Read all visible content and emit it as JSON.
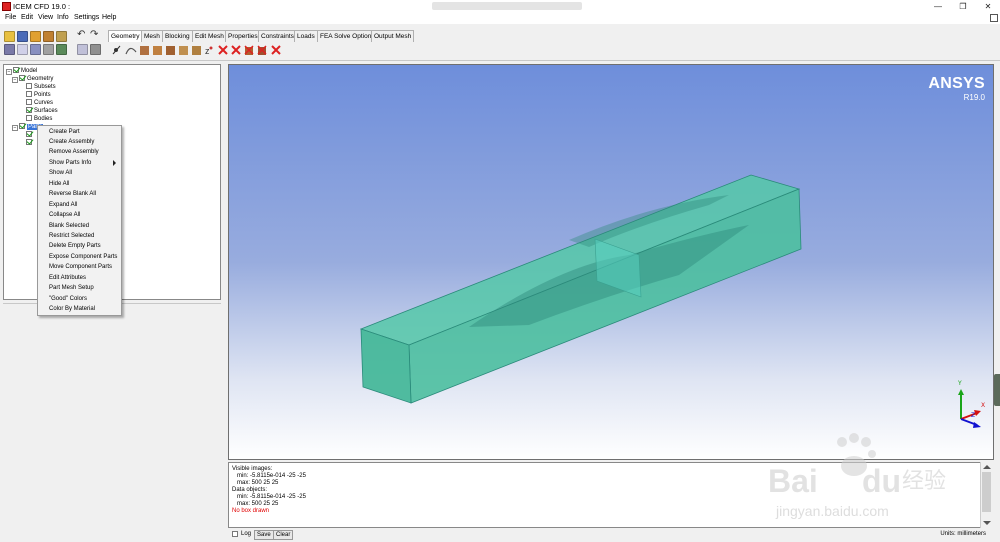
{
  "window": {
    "title": "ICEM CFD 19.0 :",
    "minimize_glyph": "—",
    "restore_glyph": "❐",
    "close_glyph": "✕"
  },
  "menubar": {
    "items": [
      "File",
      "Edit",
      "View",
      "Info",
      "Settings",
      "Help"
    ]
  },
  "toolbar": {
    "undo_glyph": "↶",
    "redo_glyph": "↷",
    "tabs": [
      "Geometry",
      "Mesh",
      "Blocking",
      "Edit Mesh",
      "Properties",
      "Constraints",
      "Loads",
      "FEA Solve Options",
      "Output Mesh"
    ],
    "active_tab": "Geometry"
  },
  "tree": {
    "root": "Model",
    "geometry": "Geometry",
    "children": [
      "Subsets",
      "Points",
      "Curves",
      "Surfaces",
      "Bodies"
    ],
    "children_checked": [
      false,
      false,
      false,
      true,
      false
    ],
    "selected_label": "Parts",
    "expander_minus": "−",
    "expander_plus": "+"
  },
  "context_menu": {
    "items": [
      "Create Part",
      "Create Assembly",
      "Remove Assembly",
      "Show Parts Info",
      "Show All",
      "Hide All",
      "Reverse Blank All",
      "Expand All",
      "Collapse All",
      "Blank Selected",
      "Restrict Selected",
      "Delete Empty Parts",
      "Expose Component Parts",
      "Move Component Parts",
      "Edit Attributes",
      "Part Mesh Setup",
      "\"Good\" Colors",
      "Color By Material"
    ],
    "submenu_index": 3
  },
  "viewport": {
    "logo": "ANSYS",
    "version": "R19.0",
    "axes": {
      "x": "X",
      "y": "Y",
      "z": "Z"
    },
    "colors": {
      "box_face": "#4fc6a6",
      "box_edge": "#2a8a7a",
      "axis_x": "#d41010",
      "axis_y": "#1aa51a",
      "axis_z": "#1010d0"
    }
  },
  "messages": {
    "lines": [
      "Visible images:",
      "   min: -5.8115e-014 -25 -25",
      "   max: 500 25 25",
      "Data objects:",
      "   min: -5.8115e-014 -25 -25",
      "   max: 500 25 25"
    ],
    "error_line": "No box drawn"
  },
  "status": {
    "log_label": "Log",
    "save_label": "Save",
    "clear_label": "Clear",
    "units": "Units: millimeters"
  },
  "watermark": {
    "brand": "Bai",
    "brand_end": "du",
    "chinese": "经验",
    "url": "jingyan.baidu.com"
  }
}
